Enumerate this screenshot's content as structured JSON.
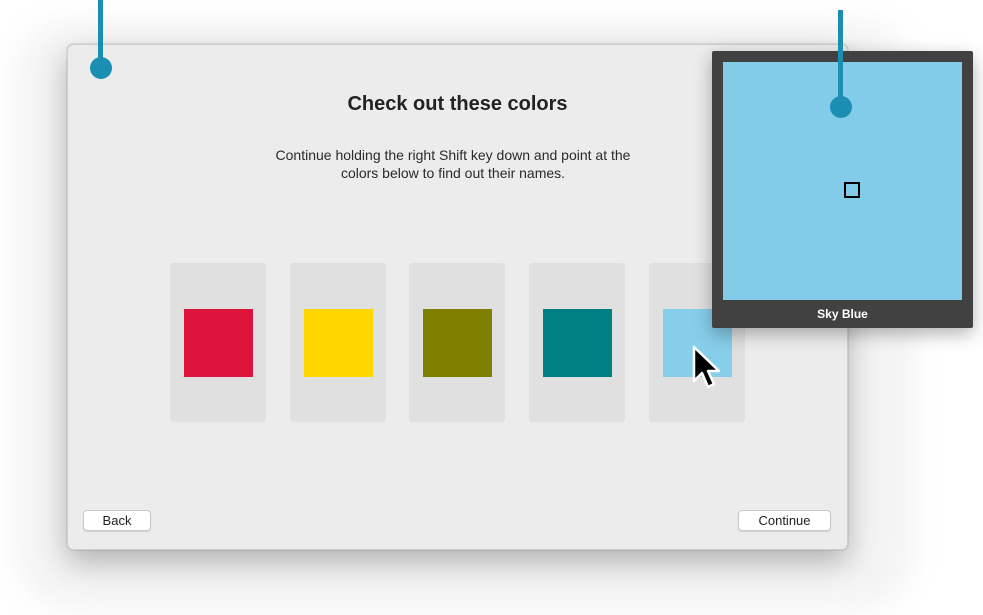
{
  "dialog": {
    "title": "Check out these colors",
    "instruction": "Continue holding the right Shift key down and point at the colors below to find out their names.",
    "swatches": [
      {
        "color": "#DC143C"
      },
      {
        "color": "#FFD700"
      },
      {
        "color": "#808000"
      },
      {
        "color": "#008080"
      },
      {
        "color": "#87CEEB"
      }
    ],
    "back_label": "Back",
    "continue_label": "Continue"
  },
  "magnifier": {
    "color_name": "Sky Blue",
    "preview_color": "#82CBE9"
  },
  "callouts": {
    "color": "#1B8FB1"
  }
}
